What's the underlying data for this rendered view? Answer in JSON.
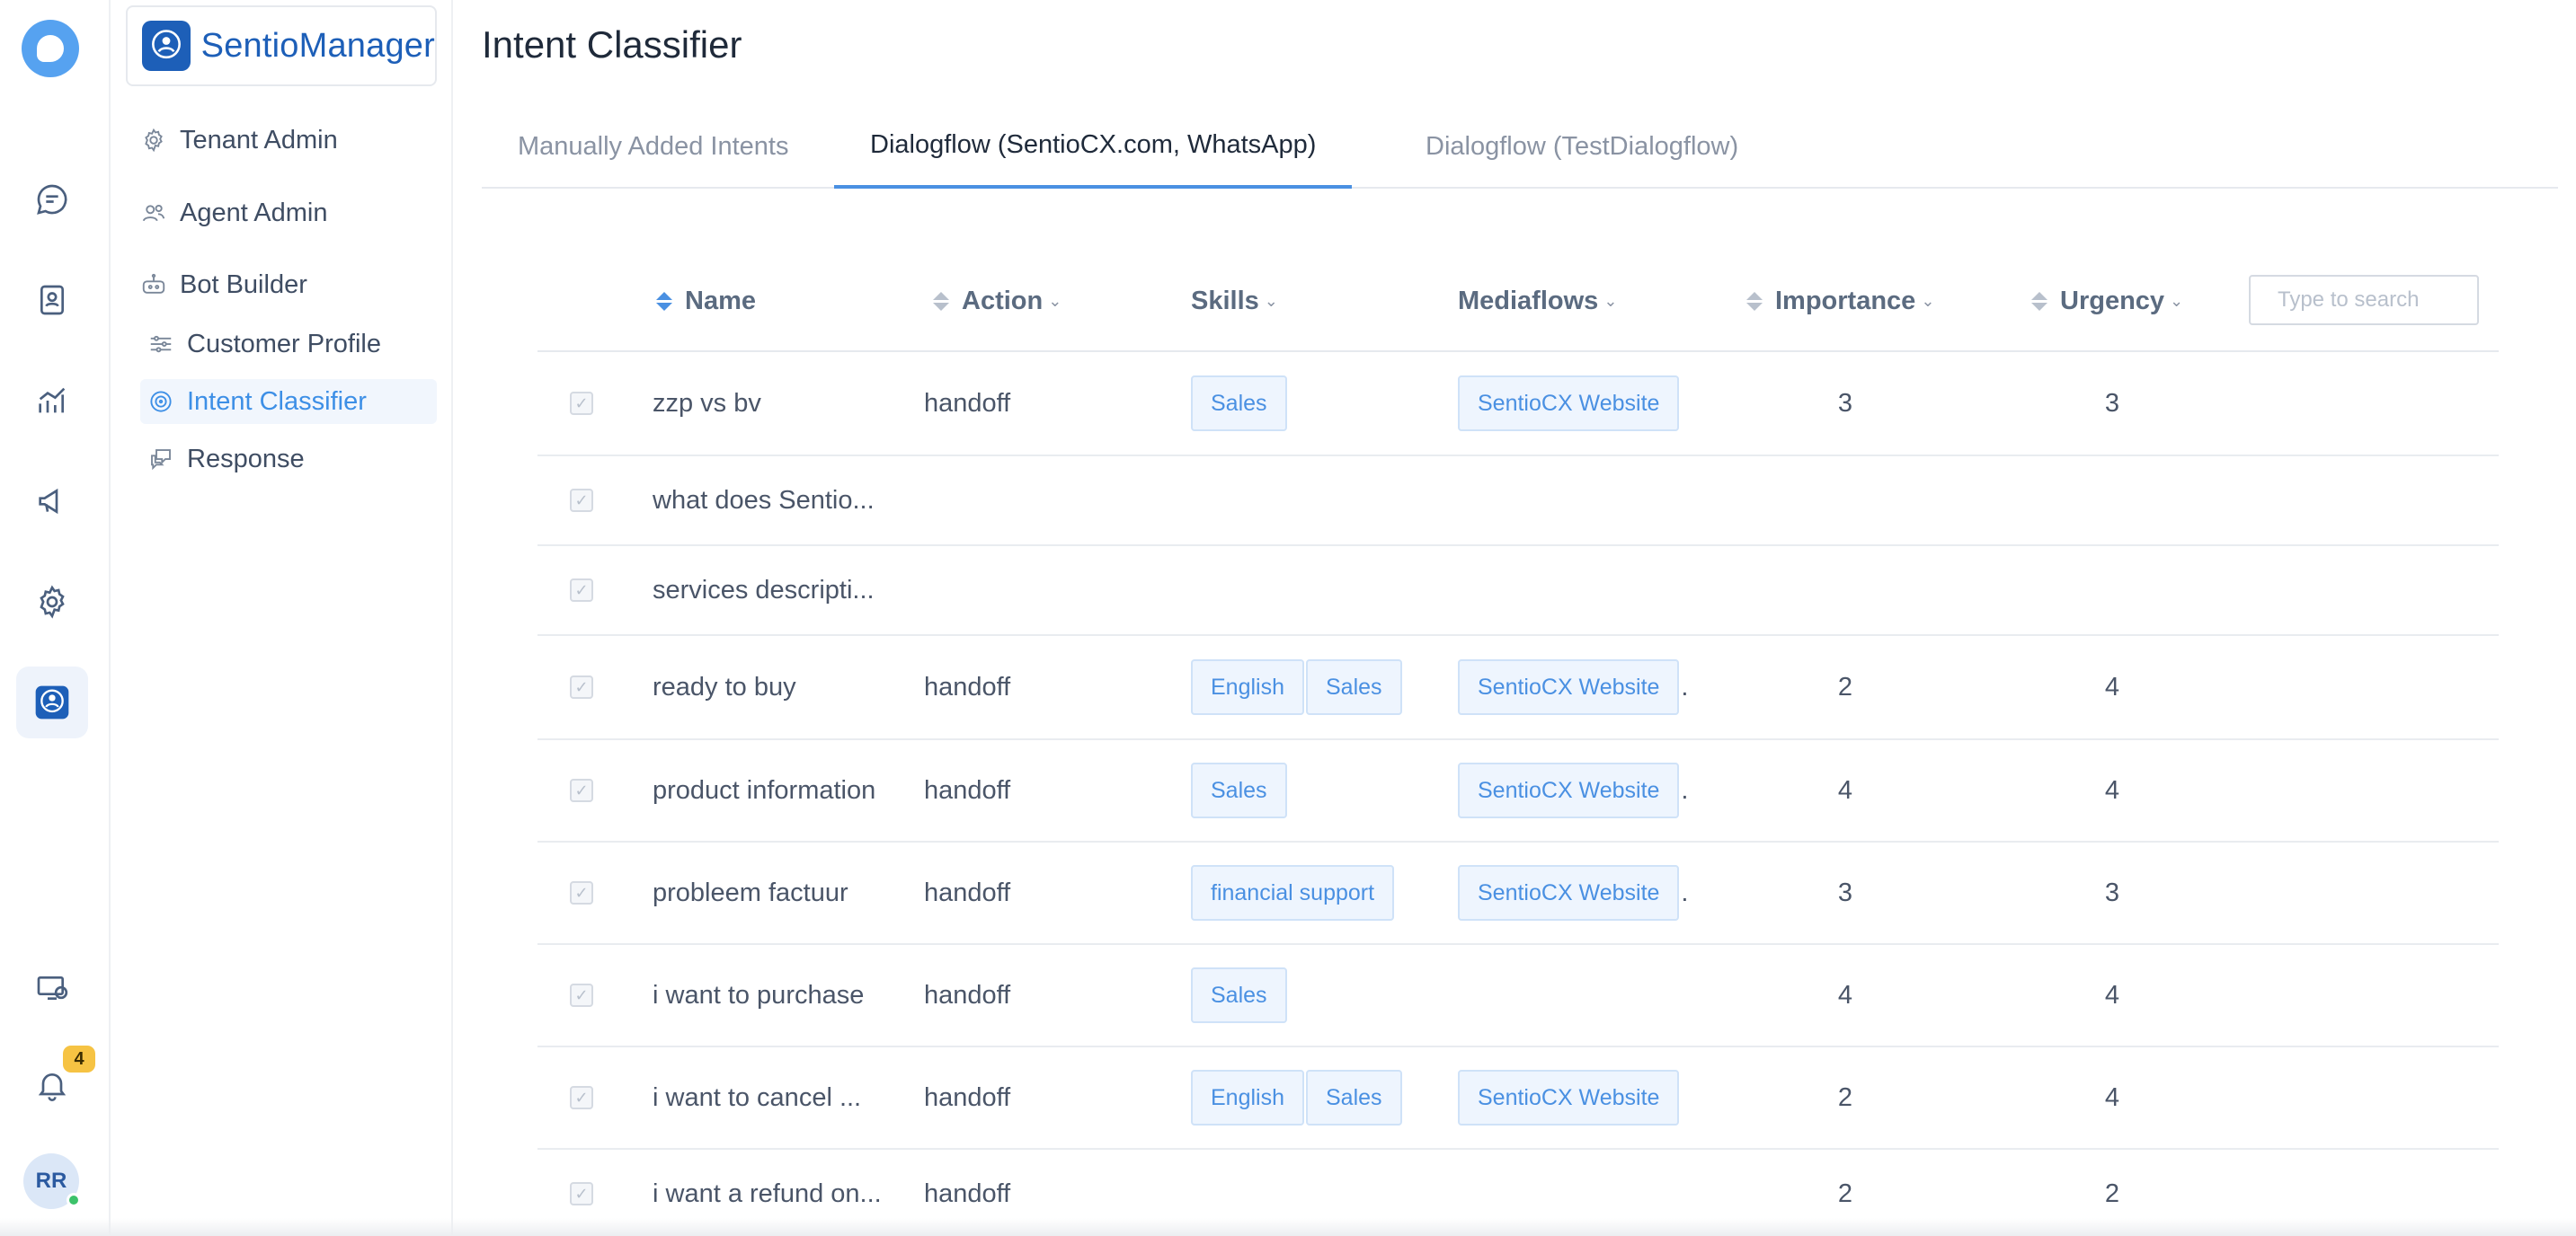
{
  "brand": {
    "name": "SentioManager"
  },
  "rail": {
    "notification_count": "4",
    "avatar_initials": "RR"
  },
  "sidebar": {
    "items": [
      {
        "label": "Tenant Admin"
      },
      {
        "label": "Agent Admin"
      },
      {
        "label": "Bot Builder"
      },
      {
        "label": "Customer Profile"
      },
      {
        "label": "Intent Classifier"
      },
      {
        "label": "Response"
      }
    ]
  },
  "main": {
    "title": "Intent Classifier",
    "tabs": [
      {
        "label": "Manually Added Intents"
      },
      {
        "label": "Dialogflow (SentioCX.com, WhatsApp)"
      },
      {
        "label": "Dialogflow (TestDialogflow)"
      }
    ],
    "active_tab": 1
  },
  "table": {
    "columns": {
      "name": "Name",
      "action": "Action",
      "skills": "Skills",
      "mediaflows": "Mediaflows",
      "importance": "Importance",
      "urgency": "Urgency"
    },
    "search_placeholder": "Type to search",
    "rows": [
      {
        "name": "zzp vs bv",
        "action": "handoff",
        "skills": [
          "Sales"
        ],
        "mediaflow": "SentioCX Website",
        "more": "",
        "importance": "3",
        "urgency": "3"
      },
      {
        "name": "what does Sentio...",
        "action": "",
        "skills": [],
        "mediaflow": "",
        "more": "",
        "importance": "",
        "urgency": ""
      },
      {
        "name": "services descripti...",
        "action": "",
        "skills": [],
        "mediaflow": "",
        "more": "",
        "importance": "",
        "urgency": ""
      },
      {
        "name": "ready to buy",
        "action": "handoff",
        "skills": [
          "English",
          "Sales"
        ],
        "mediaflow": "SentioCX Website",
        "more": ".",
        "importance": "2",
        "urgency": "4"
      },
      {
        "name": "product information",
        "action": "handoff",
        "skills": [
          "Sales"
        ],
        "mediaflow": "SentioCX Website",
        "more": ".",
        "importance": "4",
        "urgency": "4"
      },
      {
        "name": "probleem factuur",
        "action": "handoff",
        "skills": [
          "financial support"
        ],
        "mediaflow": "SentioCX Website",
        "more": ".",
        "importance": "3",
        "urgency": "3"
      },
      {
        "name": "i want to purchase",
        "action": "handoff",
        "skills": [
          "Sales"
        ],
        "mediaflow": "",
        "more": "",
        "importance": "4",
        "urgency": "4"
      },
      {
        "name": "i want to cancel ...",
        "action": "handoff",
        "skills": [
          "English",
          "Sales"
        ],
        "mediaflow": "SentioCX Website",
        "more": "",
        "importance": "2",
        "urgency": "4"
      },
      {
        "name": "i want a refund on...",
        "action": "handoff",
        "skills": [],
        "mediaflow": "",
        "more": "",
        "importance": "2",
        "urgency": "2"
      }
    ]
  }
}
